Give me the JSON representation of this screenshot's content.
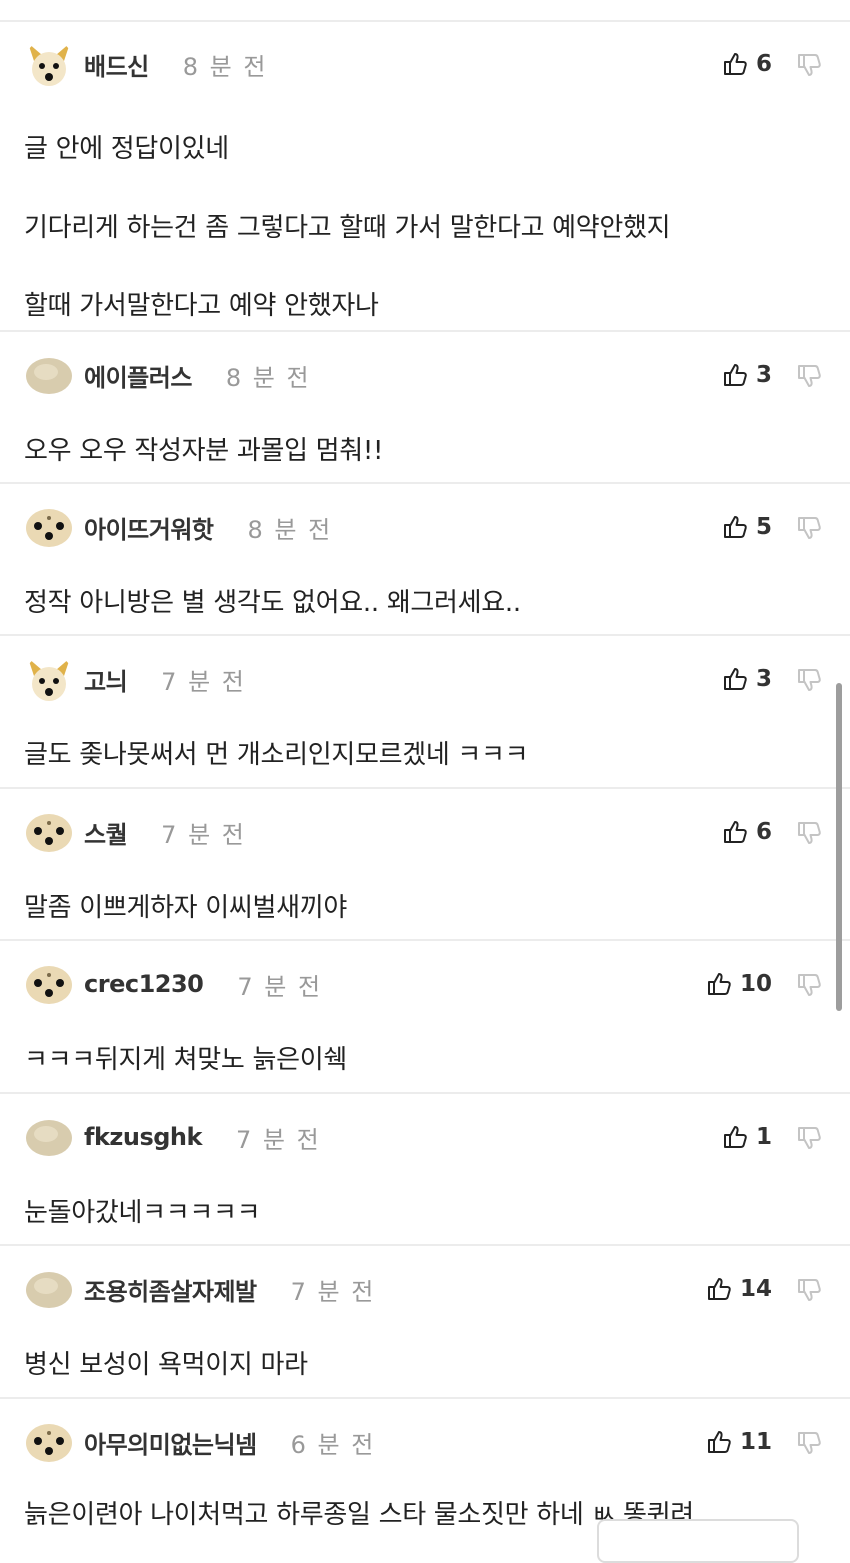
{
  "colors": {
    "divider": "#ececec",
    "time": "#999999",
    "text": "#222222",
    "scrollbar": "#9d9d9d"
  },
  "comments": [
    {
      "nickname": "배드신",
      "time": "8 분 전",
      "likes": "6",
      "avatar": "white-dog-avatar",
      "lines": [
        "글 안에 정답이있네",
        "기다리게 하는건 좀 그렇다고 할때 가서 말한다고 예약안했지",
        "할때 가서말한다고 예약 안했자나"
      ]
    },
    {
      "nickname": "에이플러스",
      "time": "8 분 전",
      "likes": "3",
      "avatar": "beige-blob-avatar",
      "lines": [
        "오우 오우 작성자분 과몰입 멈춰!!"
      ]
    },
    {
      "nickname": "아이뜨거워핫",
      "time": "8 분 전",
      "likes": "5",
      "avatar": "spotted-face-avatar",
      "lines": [
        "정작 아니방은 별 생각도 없어요.. 왜그러세요.."
      ]
    },
    {
      "nickname": "고늬",
      "time": "7 분 전",
      "likes": "3",
      "avatar": "white-dog-avatar",
      "lines": [
        "글도 좆나못써서 먼 개소리인지모르겠네 ㅋㅋㅋ"
      ]
    },
    {
      "nickname": "스퀄",
      "time": "7 분 전",
      "likes": "6",
      "avatar": "spotted-face-avatar",
      "lines": [
        "말좀 이쁘게하자 이씨벌새끼야"
      ]
    },
    {
      "nickname": "crec1230",
      "time": "7 분 전",
      "likes": "10",
      "avatar": "spotted-face-avatar",
      "lines": [
        "ㅋㅋㅋ뒤지게 쳐맞노 늙은이쉑"
      ]
    },
    {
      "nickname": "fkzusghk",
      "time": "7 분 전",
      "likes": "1",
      "avatar": "beige-blob-avatar",
      "lines": [
        "눈돌아갔네ㅋㅋㅋㅋㅋ"
      ]
    },
    {
      "nickname": "조용히좀살자제발",
      "time": "7 분 전",
      "likes": "14",
      "avatar": "beige-blob-avatar",
      "lines": [
        "병신 보성이 욕먹이지 마라"
      ]
    },
    {
      "nickname": "아무의미없는닉넴",
      "time": "6 분 전",
      "likes": "11",
      "avatar": "spotted-face-avatar",
      "lines": [
        "늙은이련아 나이처먹고 하루종일 스타 물소짓만 하네 ㅄ 똥퀴려"
      ]
    }
  ]
}
